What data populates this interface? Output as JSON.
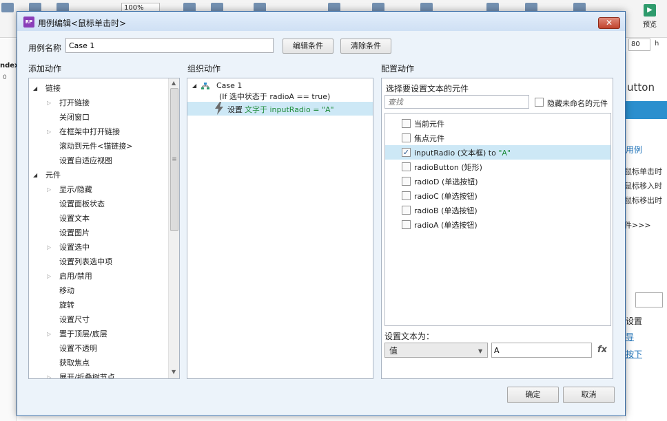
{
  "background": {
    "zoom": "100%",
    "preview_label": "预览",
    "width_value": "80",
    "h_label": "h",
    "left_label": "ndex",
    "left_zero": "0",
    "right_title": "utton",
    "right_usecase": "用例",
    "right_events": [
      "鼠标单击时",
      "鼠标移入时",
      "鼠标移出时"
    ],
    "right_more": "件>>>",
    "right_setting": "设置",
    "right_link1": "导",
    "right_link2": "按下"
  },
  "dialog": {
    "title": "用例编辑<鼠标单击时>",
    "app_icon": "RP",
    "close": "✕",
    "case_name_label": "用例名称",
    "case_name_value": "Case 1",
    "edit_condition": "编辑条件",
    "clear_condition": "清除条件",
    "ok": "确定",
    "cancel": "取消"
  },
  "add_actions": {
    "title": "添加动作",
    "items": [
      {
        "text": "链接",
        "level": 0,
        "arrow": "expanded"
      },
      {
        "text": "打开链接",
        "level": 1,
        "arrow": "collapsed"
      },
      {
        "text": "关闭窗口",
        "level": 1,
        "arrow": "none"
      },
      {
        "text": "在框架中打开链接",
        "level": 1,
        "arrow": "collapsed"
      },
      {
        "text": "滚动到元件<锚链接>",
        "level": 1,
        "arrow": "none"
      },
      {
        "text": "设置自适应视图",
        "level": 1,
        "arrow": "none"
      },
      {
        "text": "元件",
        "level": 0,
        "arrow": "expanded"
      },
      {
        "text": "显示/隐藏",
        "level": 1,
        "arrow": "collapsed"
      },
      {
        "text": "设置面板状态",
        "level": 1,
        "arrow": "none"
      },
      {
        "text": "设置文本",
        "level": 1,
        "arrow": "none"
      },
      {
        "text": "设置图片",
        "level": 1,
        "arrow": "none"
      },
      {
        "text": "设置选中",
        "level": 1,
        "arrow": "collapsed"
      },
      {
        "text": "设置列表选中项",
        "level": 1,
        "arrow": "none"
      },
      {
        "text": "启用/禁用",
        "level": 1,
        "arrow": "collapsed"
      },
      {
        "text": "移动",
        "level": 1,
        "arrow": "none"
      },
      {
        "text": "旋转",
        "level": 1,
        "arrow": "none"
      },
      {
        "text": "设置尺寸",
        "level": 1,
        "arrow": "none"
      },
      {
        "text": "置于顶层/底层",
        "level": 1,
        "arrow": "collapsed"
      },
      {
        "text": "设置不透明",
        "level": 1,
        "arrow": "none"
      },
      {
        "text": "获取焦点",
        "level": 1,
        "arrow": "none"
      },
      {
        "text": "展开/折叠树节点",
        "level": 1,
        "arrow": "collapsed"
      }
    ]
  },
  "organize": {
    "title": "组织动作",
    "case_label": "Case 1",
    "case_condition": "(If 选中状态于 radioA == true)",
    "action_set": "设置",
    "action_detail": "文字于 inputRadio = \"A\""
  },
  "configure": {
    "title": "配置动作",
    "select_label": "选择要设置文本的元件",
    "search_placeholder": "查找",
    "hide_unnamed": "隐藏未命名的元件",
    "widgets": [
      {
        "name": "当前元件",
        "suffix": "",
        "checked": false,
        "selected": false
      },
      {
        "name": "焦点元件",
        "suffix": "",
        "checked": false,
        "selected": false
      },
      {
        "name": "inputRadio (文本框) to ",
        "suffix": "\"A\"",
        "checked": true,
        "selected": true
      },
      {
        "name": "radioButton (矩形)",
        "suffix": "",
        "checked": false,
        "selected": false
      },
      {
        "name": "radioD (单选按钮)",
        "suffix": "",
        "checked": false,
        "selected": false
      },
      {
        "name": "radioC (单选按钮)",
        "suffix": "",
        "checked": false,
        "selected": false
      },
      {
        "name": "radioB (单选按钮)",
        "suffix": "",
        "checked": false,
        "selected": false
      },
      {
        "name": "radioA (单选按钮)",
        "suffix": "",
        "checked": false,
        "selected": false
      }
    ],
    "set_text_label": "设置文本为：",
    "value_type": "值",
    "value": "A",
    "fx": "fx"
  },
  "colors": {
    "selected_row": "#cde8f6",
    "accent": "#2b8fce",
    "green_text": "#1e8c3a"
  }
}
